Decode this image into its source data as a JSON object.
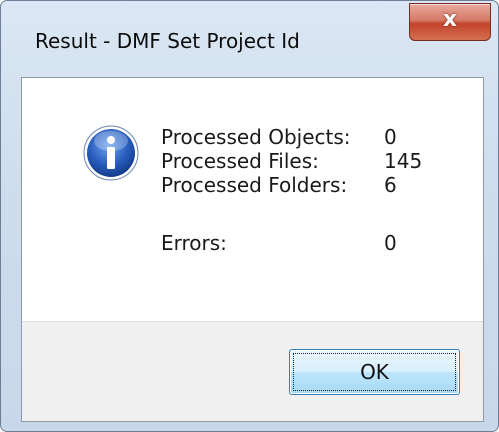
{
  "window": {
    "title": "Result - DMF Set Project Id",
    "close_glyph": "x"
  },
  "icon": {
    "name": "info-icon",
    "color": "#2a5fbf"
  },
  "results": [
    {
      "label": "Processed Objects:",
      "value": "0"
    },
    {
      "label": "Processed Files:",
      "value": "145"
    },
    {
      "label": "Processed Folders:",
      "value": "6"
    }
  ],
  "errors": {
    "label": "Errors:",
    "value": "0"
  },
  "buttons": {
    "ok_label": "OK"
  }
}
